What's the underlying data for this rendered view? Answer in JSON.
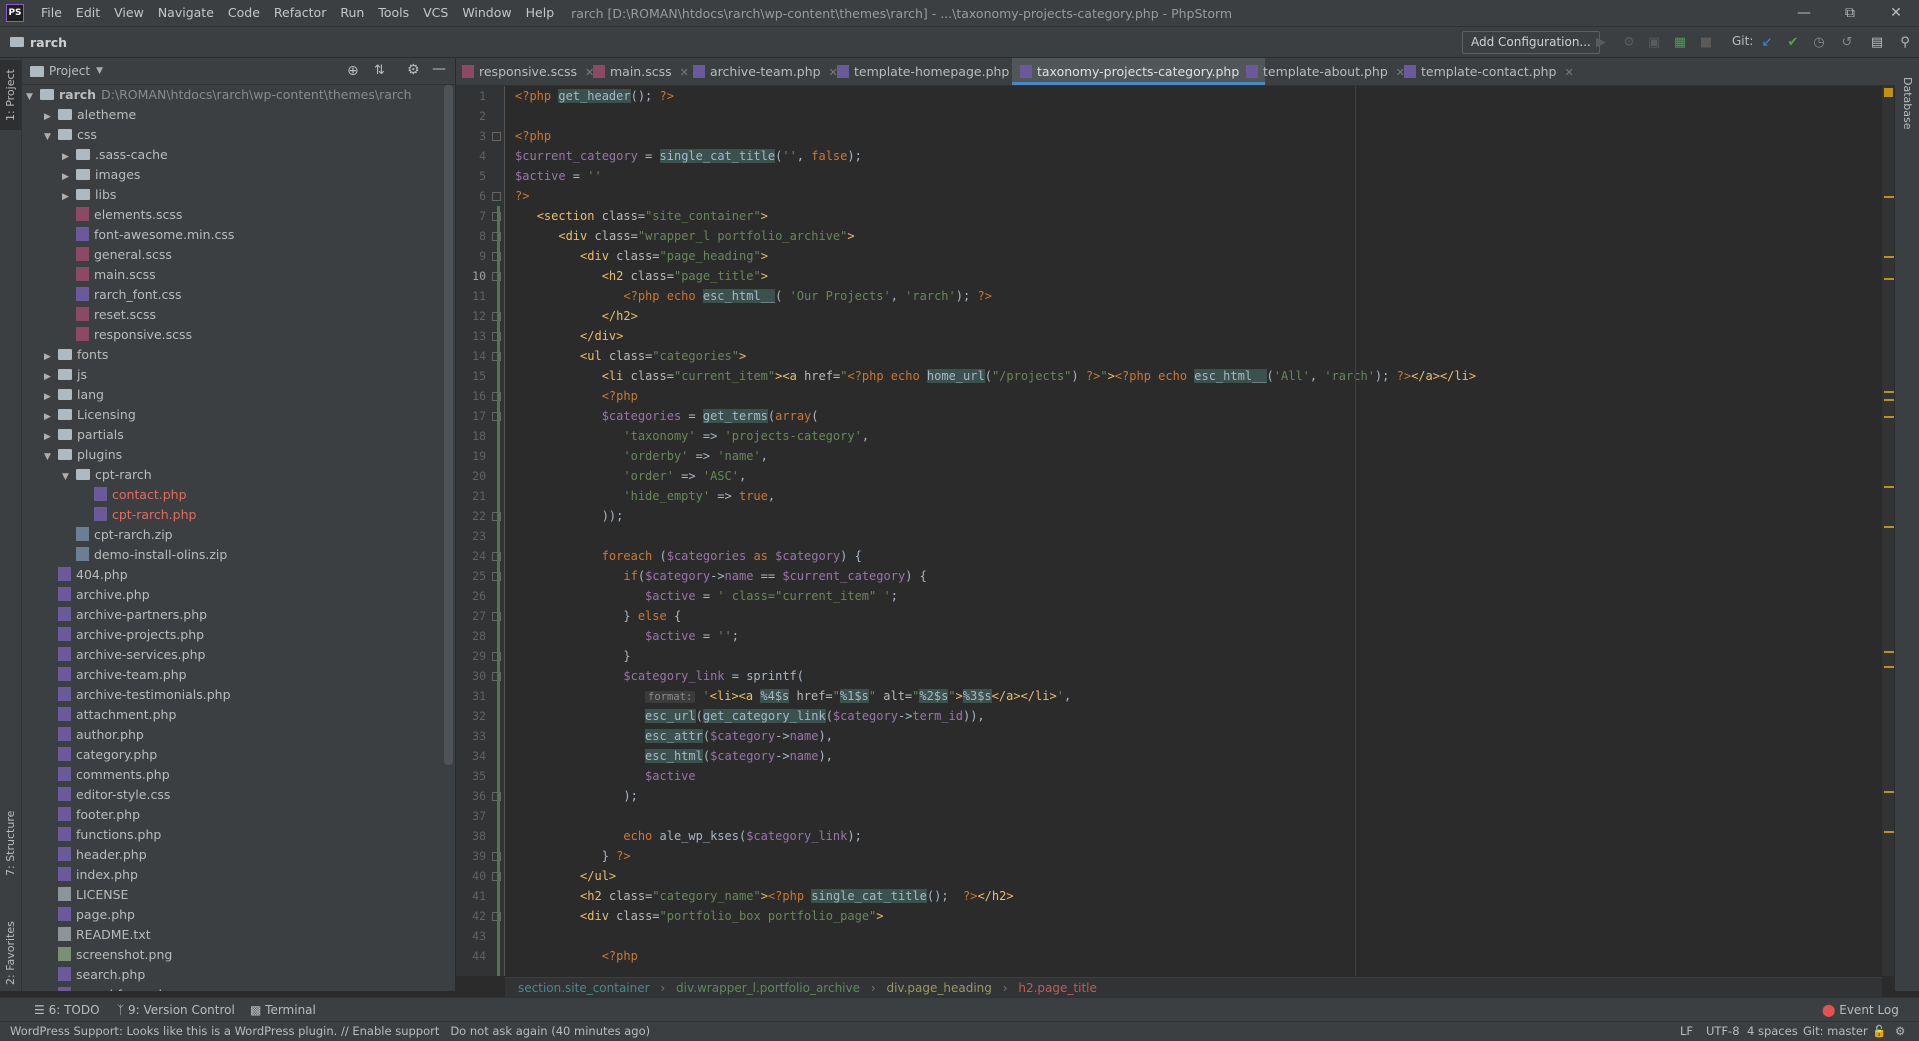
{
  "window": {
    "title": "rarch [D:\\ROMAN\\htdocs\\rarch\\wp-content\\themes\\rarch] - ...\\taxonomy-projects-category.php - PhpStorm",
    "logo_text": "PS"
  },
  "menu": [
    "File",
    "Edit",
    "View",
    "Navigate",
    "Code",
    "Refactor",
    "Run",
    "Tools",
    "VCS",
    "Window",
    "Help"
  ],
  "navbar": {
    "project": "rarch",
    "add_config": "Add Configuration...",
    "git_label": "Git:"
  },
  "project_panel": {
    "title": "Project",
    "root_name": "rarch",
    "root_path": "D:\\ROMAN\\htdocs\\rarch\\wp-content\\themes\\rarch",
    "items": [
      {
        "name": "aletheme",
        "type": "folder",
        "expanded": false
      },
      {
        "name": "css",
        "type": "folder",
        "expanded": true
      },
      {
        "name": ".sass-cache",
        "type": "folder",
        "expanded": false
      },
      {
        "name": "images",
        "type": "folder",
        "expanded": false
      },
      {
        "name": "libs",
        "type": "folder",
        "expanded": false
      },
      {
        "name": "elements.scss",
        "type": "scss"
      },
      {
        "name": "font-awesome.min.css",
        "type": "css"
      },
      {
        "name": "general.scss",
        "type": "scss"
      },
      {
        "name": "main.scss",
        "type": "scss"
      },
      {
        "name": "rarch_font.css",
        "type": "css"
      },
      {
        "name": "reset.scss",
        "type": "scss"
      },
      {
        "name": "responsive.scss",
        "type": "scss"
      },
      {
        "name": "fonts",
        "type": "folder",
        "expanded": false
      },
      {
        "name": "js",
        "type": "folder",
        "expanded": false
      },
      {
        "name": "lang",
        "type": "folder",
        "expanded": false
      },
      {
        "name": "Licensing",
        "type": "folder",
        "expanded": false
      },
      {
        "name": "partials",
        "type": "folder",
        "expanded": false
      },
      {
        "name": "plugins",
        "type": "folder",
        "expanded": true
      },
      {
        "name": "cpt-rarch",
        "type": "folder",
        "expanded": true
      },
      {
        "name": "contact.php",
        "type": "php",
        "modified": true
      },
      {
        "name": "cpt-rarch.php",
        "type": "php",
        "modified": true
      },
      {
        "name": "cpt-rarch.zip",
        "type": "zip"
      },
      {
        "name": "demo-install-olins.zip",
        "type": "zip"
      },
      {
        "name": "404.php",
        "type": "php"
      },
      {
        "name": "archive.php",
        "type": "php"
      },
      {
        "name": "archive-partners.php",
        "type": "php"
      },
      {
        "name": "archive-projects.php",
        "type": "php"
      },
      {
        "name": "archive-services.php",
        "type": "php"
      },
      {
        "name": "archive-team.php",
        "type": "php"
      },
      {
        "name": "archive-testimonials.php",
        "type": "php"
      },
      {
        "name": "attachment.php",
        "type": "php"
      },
      {
        "name": "author.php",
        "type": "php"
      },
      {
        "name": "category.php",
        "type": "php"
      },
      {
        "name": "comments.php",
        "type": "php"
      },
      {
        "name": "editor-style.css",
        "type": "css"
      },
      {
        "name": "footer.php",
        "type": "php"
      },
      {
        "name": "functions.php",
        "type": "php"
      },
      {
        "name": "header.php",
        "type": "php"
      },
      {
        "name": "index.php",
        "type": "php"
      },
      {
        "name": "LICENSE",
        "type": "txt"
      },
      {
        "name": "page.php",
        "type": "php"
      },
      {
        "name": "README.txt",
        "type": "txt"
      },
      {
        "name": "screenshot.png",
        "type": "png"
      },
      {
        "name": "search.php",
        "type": "php"
      },
      {
        "name": "searchform.php",
        "type": "php"
      }
    ]
  },
  "tabs": [
    {
      "label": "responsive.scss",
      "active": false,
      "type": "scss"
    },
    {
      "label": "main.scss",
      "active": false,
      "type": "scss"
    },
    {
      "label": "archive-team.php",
      "active": false,
      "type": "php"
    },
    {
      "label": "template-homepage.php",
      "active": false,
      "type": "php"
    },
    {
      "label": "taxonomy-projects-category.php",
      "active": true,
      "type": "php"
    },
    {
      "label": "template-about.php",
      "active": false,
      "type": "php"
    },
    {
      "label": "template-contact.php",
      "active": false,
      "type": "php"
    }
  ],
  "code": {
    "current_line": 10,
    "line_numbers": [
      "1",
      "2",
      "3",
      "4",
      "5",
      "6",
      "7",
      "8",
      "9",
      "10",
      "11",
      "12",
      "13",
      "14",
      "15",
      "16",
      "17",
      "18",
      "19",
      "20",
      "21",
      "22",
      "23",
      "24",
      "25",
      "26",
      "27",
      "28",
      "29",
      "30",
      "31",
      "32",
      "33",
      "34",
      "35",
      "36",
      "37",
      "38",
      "39",
      "40",
      "41",
      "42",
      "43",
      "44"
    ]
  },
  "breadcrumb": [
    "section.site_container",
    "div.wrapper_l.portfolio_archive",
    "div.page_heading",
    "h2.page_title"
  ],
  "tool_strip": {
    "left": [
      "1: Project",
      "7: Structure",
      "2: Favorites"
    ],
    "right": [
      "Database"
    ]
  },
  "bottom_tools": [
    "6: TODO",
    "9: Version Control",
    "Terminal"
  ],
  "event_log": "Event Log",
  "status": {
    "message": "WordPress Support: Looks like this is a WordPress plugin. // Enable support   Do not ask again (40 minutes ago)",
    "line_sep": "LF",
    "encoding": "UTF-8",
    "indent": "4 spaces",
    "git": "Git: master"
  },
  "colors": {
    "background": "#2b2b2b",
    "panel": "#3c3f41",
    "keyword": "#cc7832",
    "string": "#6a8759",
    "variable": "#9876aa",
    "tag": "#e8bf6a",
    "function": "#ffc66d"
  }
}
